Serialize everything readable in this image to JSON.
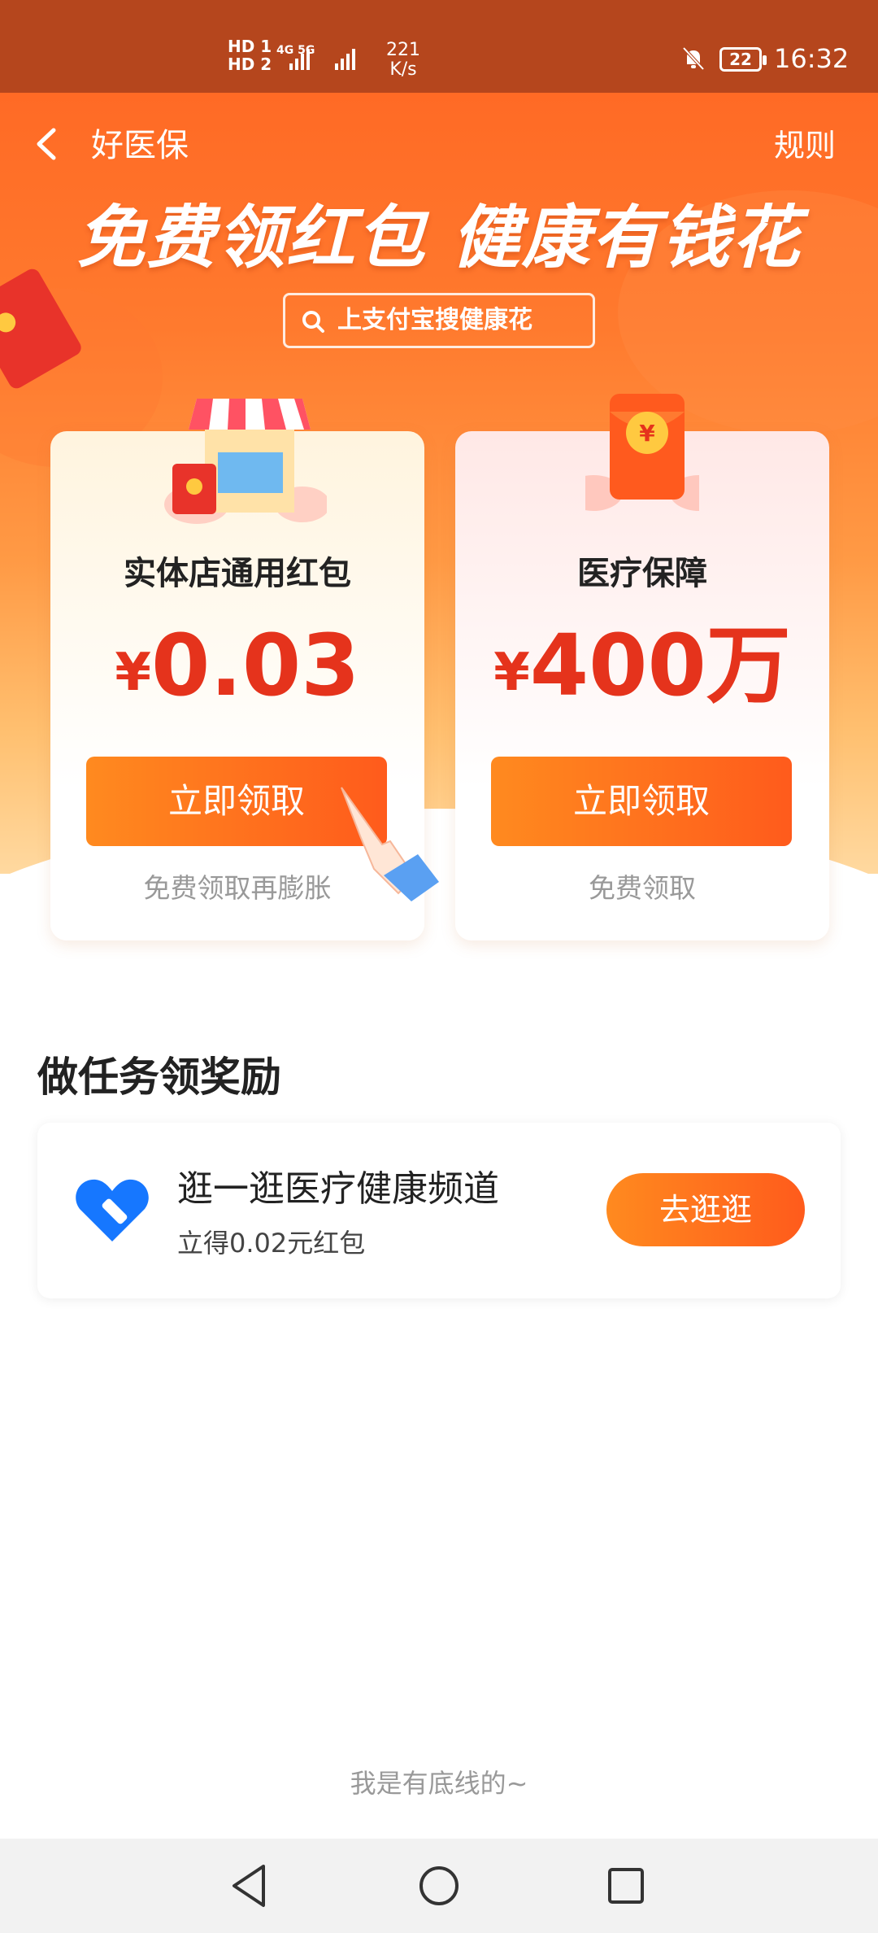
{
  "status_bar": {
    "sim1": "HD 1",
    "sim2": "HD 2",
    "network": "4G 5G",
    "speed_value": "221",
    "speed_unit": "K/s",
    "battery": "22",
    "time": "16:32"
  },
  "header": {
    "title": "好医保",
    "rules": "规则"
  },
  "hero": {
    "slogan": "免费领红包  健康有钱花",
    "search_text": "上支付宝搜健康花"
  },
  "cards": [
    {
      "title": "实体店通用红包",
      "currency": "¥",
      "amount": "0.03",
      "button": "立即领取",
      "hint": "免费领取再膨胀"
    },
    {
      "title": "医疗保障",
      "currency": "¥",
      "amount": "400万",
      "button": "立即领取",
      "hint": "免费领取"
    }
  ],
  "tasks": {
    "section_title": "做任务领奖励",
    "items": [
      {
        "title": "逛一逛医疗健康频道",
        "subtitle": "立得0.02元红包",
        "button": "去逛逛",
        "icon": "heart-health-icon"
      }
    ]
  },
  "footer": "我是有底线的~",
  "colors": {
    "accent": "#ff5b1c",
    "amount_red": "#e5331c",
    "status_bar": "#b5461d"
  }
}
